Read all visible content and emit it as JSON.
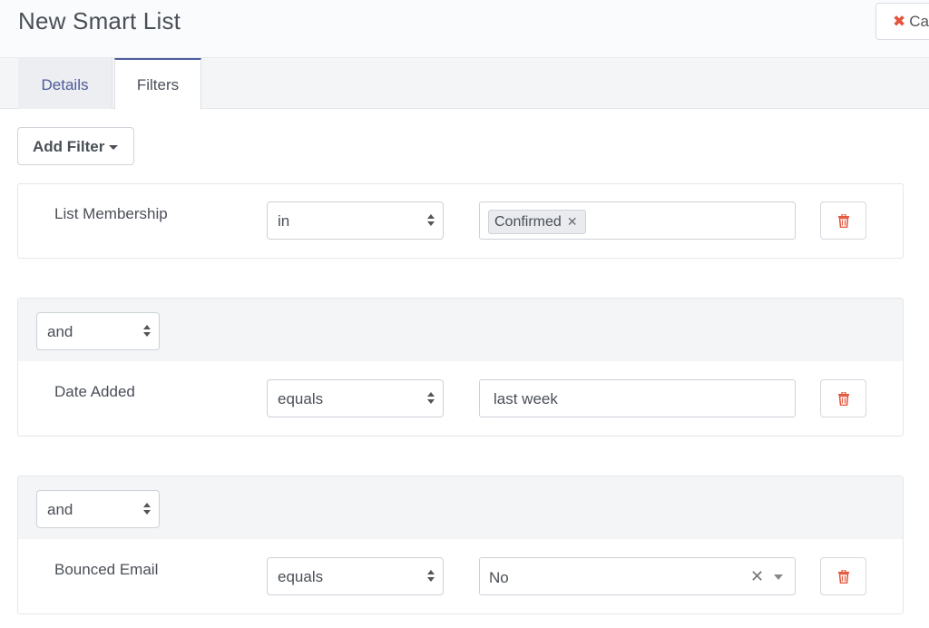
{
  "header": {
    "title": "New Smart List",
    "cancel_label": "Ca",
    "cancel_icon": "close-icon"
  },
  "tabs": [
    {
      "label": "Details",
      "active": false
    },
    {
      "label": "Filters",
      "active": true
    }
  ],
  "toolbar": {
    "add_filter_label": "Add Filter"
  },
  "filters": [
    {
      "field": "List Membership",
      "operator": "in",
      "value_type": "chips",
      "chips": [
        "Confirmed"
      ]
    },
    {
      "glue": "and",
      "field": "Date Added",
      "operator": "equals",
      "value_type": "text",
      "value": "last week"
    },
    {
      "glue": "and",
      "field": "Bounced Email",
      "operator": "equals",
      "value_type": "combo",
      "value": "No"
    }
  ],
  "colors": {
    "accent": "#4e5d9d",
    "danger": "#e4553b"
  }
}
